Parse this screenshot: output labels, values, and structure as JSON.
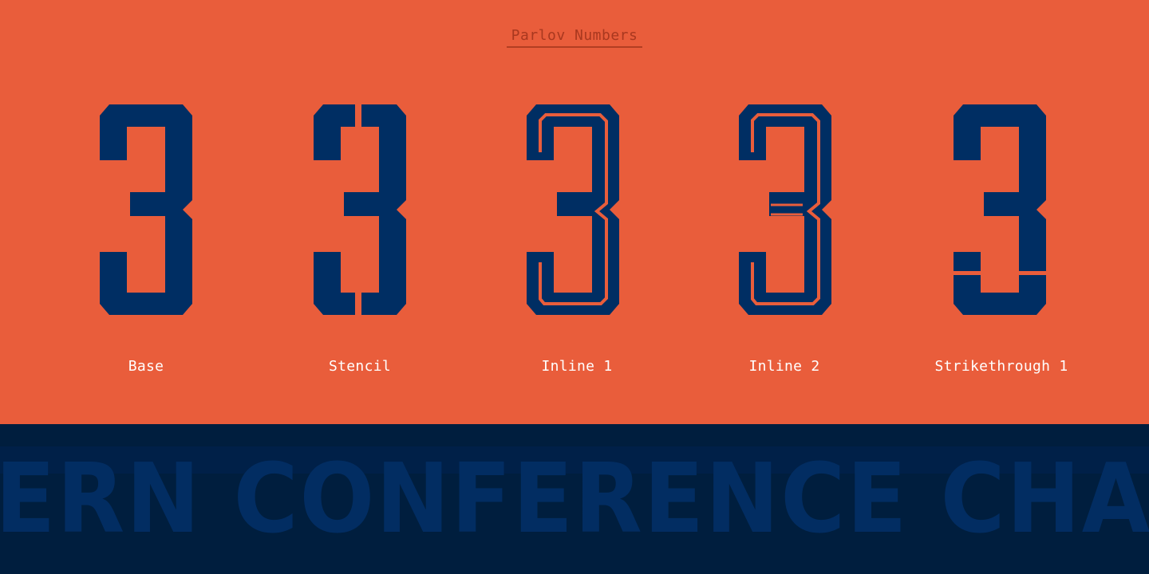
{
  "header": {
    "title": "Parlov Numbers"
  },
  "variants": [
    {
      "glyph": "3",
      "label": "Base"
    },
    {
      "glyph": "3",
      "label": "Stencil"
    },
    {
      "glyph": "3",
      "label": "Inline 1"
    },
    {
      "glyph": "3",
      "label": "Inline 2"
    },
    {
      "glyph": "3",
      "label": "Strikethrough 1"
    }
  ],
  "banner": {
    "text": "ERN CONFERENCE CHAMPI"
  },
  "colors": {
    "background": "#E95D3B",
    "glyph": "#002E63",
    "banner_background": "#001E3E",
    "banner_text": "#022D62",
    "title_text": "#A9381F",
    "label_text": "#FFFFFF"
  }
}
